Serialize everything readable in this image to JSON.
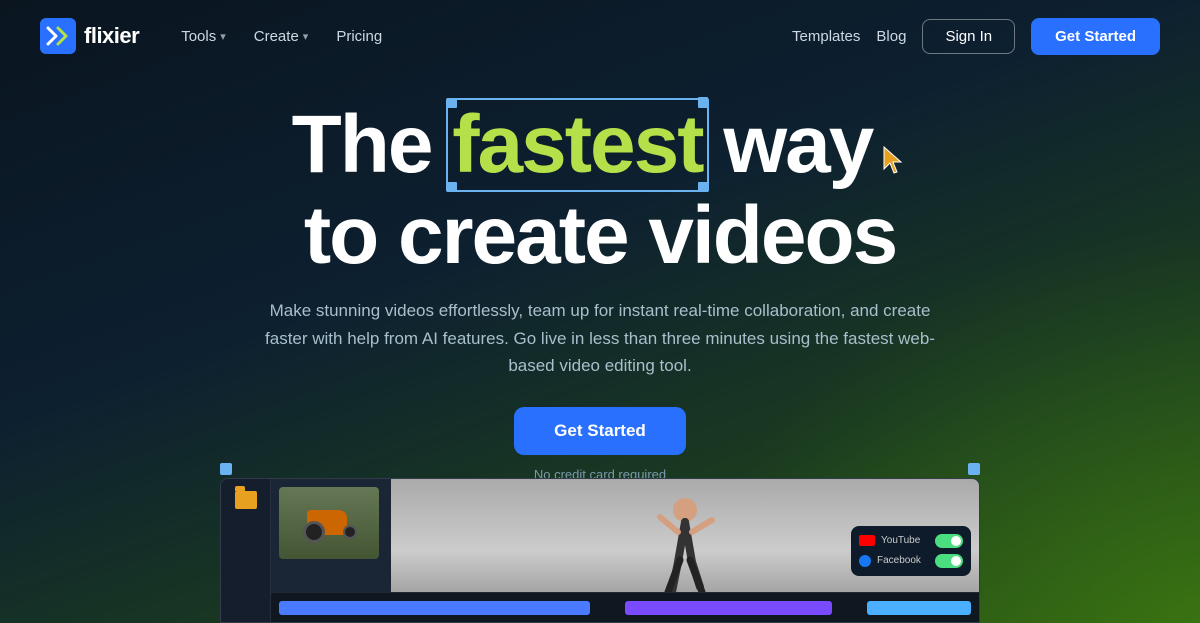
{
  "nav": {
    "logo_text": "flixier",
    "tools_label": "Tools",
    "create_label": "Create",
    "pricing_label": "Pricing",
    "templates_label": "Templates",
    "blog_label": "Blog",
    "signin_label": "Sign In",
    "getstarted_label": "Get Started"
  },
  "hero": {
    "headline_pre": "The ",
    "headline_fast": "fastest",
    "headline_post": " way",
    "headline_line2": "to create videos",
    "subtext": "Make stunning videos effortlessly, team up for instant real-time collaboration, and create faster with help from AI features. Go live in less than three minutes using the fastest web-based video editing tool.",
    "cta_label": "Get Started",
    "no_cc": "No credit card required"
  },
  "social": {
    "youtube_label": "YouTube",
    "facebook_label": "Facebook"
  }
}
